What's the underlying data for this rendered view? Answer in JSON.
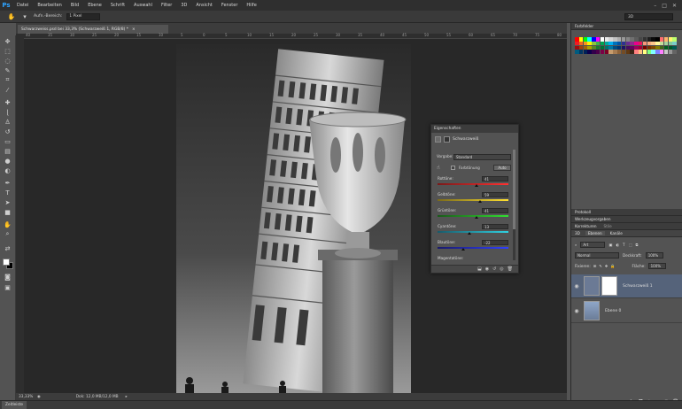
{
  "app": {
    "logo": "Ps"
  },
  "menu": [
    "Datei",
    "Bearbeiten",
    "Bild",
    "Ebene",
    "Schrift",
    "Auswahl",
    "Filter",
    "3D",
    "Ansicht",
    "Fenster",
    "Hilfe"
  ],
  "window_controls": [
    "–",
    "□",
    "✕"
  ],
  "options": {
    "tool_icon": "hand-icon",
    "label": "Aufn.-Bereich:",
    "sample_value": "1 Pixel",
    "workspace": "3D"
  },
  "document": {
    "tab_label": "Schwarzweiss.psd bei 33,3% (Schwarzweiß 1, RGB/8) *",
    "zoom": "33,33%",
    "info": "Dok: 12,0 MB/12,0 MB"
  },
  "ruler_h": [
    "40",
    "35",
    "30",
    "25",
    "20",
    "15",
    "10",
    "5",
    "0",
    "5",
    "10",
    "15",
    "20",
    "25",
    "30",
    "35",
    "40",
    "45",
    "50",
    "55",
    "60",
    "65",
    "70",
    "75",
    "80"
  ],
  "timeline": {
    "tab": "Zeitleiste"
  },
  "properties": {
    "title": "Eigenschaften",
    "header": "Schwarzweiß",
    "preset_label": "Vorgabe:",
    "preset_value": "Standard",
    "tint_label": "Farbtönung",
    "auto_label": "Auto",
    "sliders": [
      {
        "label": "Rottöne:",
        "value": "41",
        "pos": 0.55
      },
      {
        "label": "Gelbtöne:",
        "value": "59",
        "pos": 0.6
      },
      {
        "label": "Grüntöne:",
        "value": "41",
        "pos": 0.55
      },
      {
        "label": "Cyantöne:",
        "value": "13",
        "pos": 0.45
      },
      {
        "label": "Blautöne:",
        "value": "-22",
        "pos": 0.36
      },
      {
        "label": "Magentatöne:",
        "value": "",
        "pos": null
      }
    ]
  },
  "right_panel": {
    "swatches_tab": "Farbfelder",
    "tabs_mid": [
      "Protokoll",
      "Werkzeugvorgaben",
      "Korrekturen",
      "Stile"
    ],
    "layers_tabs": [
      "3D",
      "Ebenen",
      "Kanäle"
    ],
    "filter_label": "Art",
    "blend_mode": "Normal",
    "opacity_label": "Deckkraft:",
    "opacity_value": "100%",
    "lock_label": "Fixieren:",
    "fill_label": "Fläche:",
    "fill_value": "100%",
    "layers": [
      {
        "name": "Schwarzweiß 1",
        "selected": true
      },
      {
        "name": "Ebene 0",
        "selected": false
      }
    ]
  },
  "swatch_colors": [
    "#ff0000",
    "#ffff00",
    "#00ff00",
    "#00ffff",
    "#0000ff",
    "#ff00ff",
    "#ffffff",
    "#ebebeb",
    "#d6d6d6",
    "#c2c2c2",
    "#adadad",
    "#999999",
    "#858585",
    "#707070",
    "#5c5c5c",
    "#474747",
    "#333333",
    "#1f1f1f",
    "#0a0a0a",
    "#000000",
    "#ff6e6e",
    "#ffb36e",
    "#fff36e",
    "#bfff6e",
    "#ee1d24",
    "#f26522",
    "#f7941d",
    "#fff200",
    "#8dc63f",
    "#39b54a",
    "#00a651",
    "#00a99d",
    "#00aeef",
    "#0072bc",
    "#0054a6",
    "#2e3192",
    "#662d91",
    "#92278f",
    "#ec008c",
    "#ed145b",
    "#f7977a",
    "#f9ad81",
    "#fdc68a",
    "#fff79a",
    "#c4df9b",
    "#a3d39c",
    "#82ca9d",
    "#7bcdc8",
    "#9e0b0f",
    "#a0410d",
    "#a36209",
    "#aba000",
    "#598527",
    "#1a7b30",
    "#007236",
    "#00746b",
    "#0076a3",
    "#004b80",
    "#003471",
    "#1b1464",
    "#440e62",
    "#630460",
    "#9e005d",
    "#9e0039",
    "#790000",
    "#7b2e00",
    "#7d4900",
    "#827b00",
    "#406618",
    "#005e20",
    "#005826",
    "#005952",
    "#005b7f",
    "#003663",
    "#002157",
    "#0d004c",
    "#32004b",
    "#4b0049",
    "#7b0046",
    "#7a0026",
    "#c69c6d",
    "#a67c52",
    "#8c6239",
    "#754c24",
    "#603913",
    "#3c2415",
    "#ff8080",
    "#ffbf80",
    "#ffff80",
    "#80ff80",
    "#80ffff",
    "#8080ff",
    "#ff80ff",
    "#c8c8c8",
    "#969696",
    "#646464"
  ],
  "colors": {
    "accent": "#2fa3ff",
    "selected_layer": "#55637a"
  }
}
